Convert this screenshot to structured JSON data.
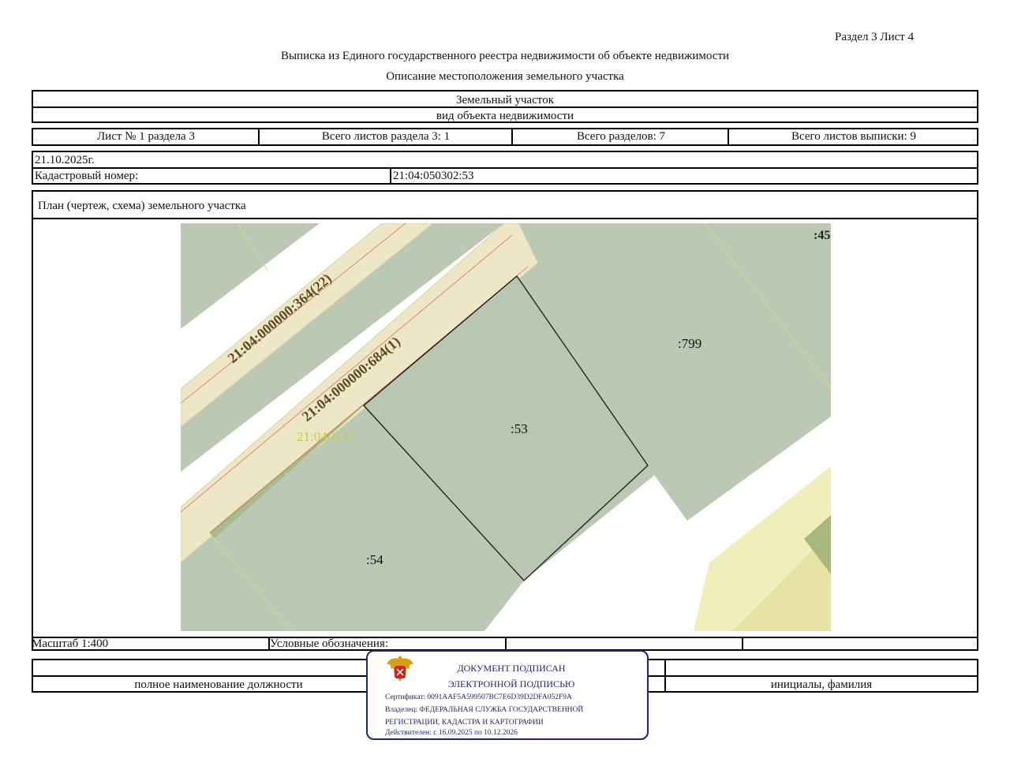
{
  "header": {
    "section_sheet": "Раздел 3   Лист 4",
    "title": "Выписка из Единого государственного реестра недвижимости об объекте недвижимости",
    "subtitle": "Описание местоположения земельного участка"
  },
  "object": {
    "type": "Земельный участок",
    "type_caption": "вид объекта недвижимости"
  },
  "sheet_info": {
    "sheet": "Лист № 1 раздела 3",
    "total_section_sheets": "Всего листов раздела 3: 1",
    "total_sections": "Всего разделов: 7",
    "total_extract_sheets": "Всего листов выписки: 9"
  },
  "date": "21.10.2025г.",
  "cadastral": {
    "label": "Кадастровый номер:",
    "value": "21:04:050302:53"
  },
  "plan": {
    "title": "План (чертеж, схема) земельного участка",
    "labels": {
      "road1": "21:04:000000:364(22)",
      "road2": "21:04:000000:684(1)",
      "zone": "21:04-6.47",
      "p53": ":53",
      "p54": ":54",
      "p799": ":799",
      "p45": ":45"
    }
  },
  "footer": {
    "scale": "Масштаб 1:400",
    "legend": "Условные обозначения:",
    "position_caption": "полное наименование должности",
    "name_caption": "инициалы, фамилия"
  },
  "stamp": {
    "line1": "ДОКУМЕНТ ПОДПИСАН",
    "line2": "ЭЛЕКТРОННОЙ ПОДПИСЬЮ",
    "certificate": "Сертификат: 0091AAF5A599507BC7E6D39D2DFA052F9A",
    "owner1": "Владелец: ФЕДЕРАЛЬНАЯ СЛУЖБА ГОСУДАРСТВЕННОЙ",
    "owner2": "РЕГИСТРАЦИИ, КАДАСТРА И КАРТОГРАФИИ",
    "valid": "Действителен: с 16.09.2025 по 10.12.2026"
  },
  "colors": {
    "parcel_fill": "#bac8b4",
    "road_fill": "#ede7c6",
    "zone_fill": "#f0eebb",
    "boundary": "#1a1a1a",
    "stamp_blue": "#1d2a6e"
  }
}
